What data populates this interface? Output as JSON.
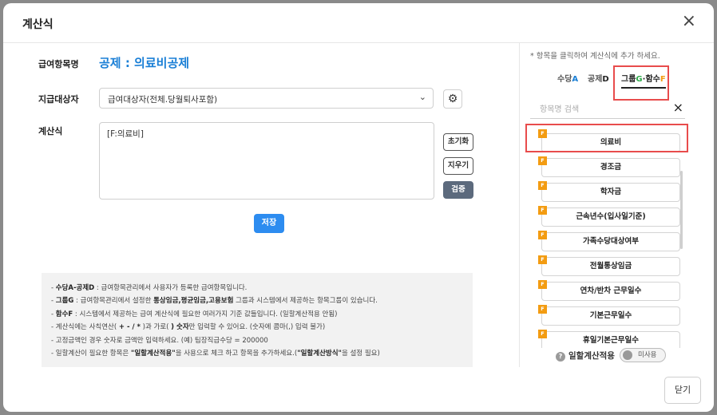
{
  "modal": {
    "title": "계산식",
    "close_symbol": "×"
  },
  "form": {
    "item_name_label": "급여항목명",
    "item_name_value": "공제 : 의료비공제",
    "target_label": "지급대상자",
    "target_value": "급여대상자(전체.당월퇴사포함)",
    "formula_label": "계산식",
    "formula_value": "[F:의료비]",
    "reset_label": "초기화",
    "clear_label": "지우기",
    "verify_label": "검증",
    "save_label": "저장"
  },
  "notes": {
    "line1": {
      "bold": "수당A-공제D",
      "rest": " : 급여항목관리에서 사용자가 등록한 급여항목입니다."
    },
    "line2": {
      "bold1": "그룹G",
      "mid1": " : 급여항목관리에서 설정한 ",
      "bold2": "통상임금,평균임금,고용보험",
      "rest": " 그룹과 시스템에서 제공하는 항목그룹이 있습니다."
    },
    "line3": {
      "bold": "함수F",
      "rest": " : 시스템에서 제공하는 급여 계산식에 필요한 여러가지 기준 값들입니다. (일할계산적용 안됨)"
    },
    "line4": {
      "pre": "계산식에는 사칙연산( ",
      "bold1": "+ - / *",
      "mid": " )과 가로( ",
      "bold2": ") 숫자",
      "rest": "만 입력할 수 있어요. (숫자에 콤마(,) 입력 불가)"
    },
    "line5": "고정금액인 경우 숫자로 금액만 입력하세요. (예) 팀장직급수당 = 200000",
    "line6": {
      "pre": "일할계산이 필요한 항목은 ",
      "bold1": "\"일할계산적용\"",
      "mid": "을 사용으로 체크 하고 항목을 추가하세요.(",
      "bold2": "\"일할계산방식\"",
      "rest": "을 설정 필요)"
    }
  },
  "panel": {
    "hint": "* 항목을 클릭하여 계산식에 추가 하세요.",
    "tabs": {
      "t1": {
        "label": "수당",
        "suffix": "A"
      },
      "t2": {
        "label": "공제",
        "suffix": "D"
      },
      "t3": {
        "label": "그룹",
        "g": "G",
        "dot": "·",
        "label2": "함수",
        "f": "F"
      }
    },
    "search_placeholder": "항목명 검색",
    "search_clear": "×",
    "badge": "F",
    "items": [
      "의료비",
      "경조금",
      "학자금",
      "근속년수(입사일기준)",
      "가족수당대상여부",
      "전월통상임금",
      "연차/반차 근무일수",
      "기본근무일수",
      "휴일기본근무일수"
    ],
    "bulk_label": "일할계산적용",
    "toggle_label": "미사용"
  },
  "footer": {
    "close_label": "닫기"
  },
  "colors": {
    "accent": "#1a7fd6",
    "save": "#2d8cf0",
    "badge": "#f39c12",
    "highlight": "#e84c4c"
  }
}
